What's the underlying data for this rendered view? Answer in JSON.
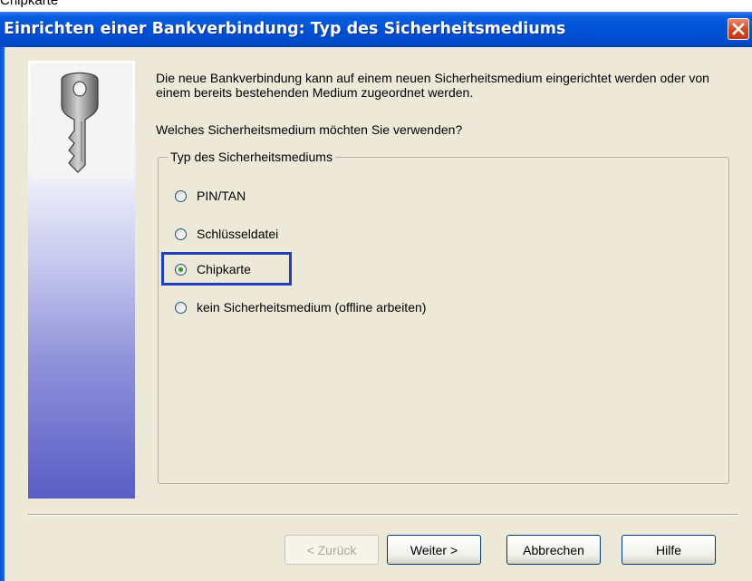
{
  "window": {
    "title": "Einrichten einer Bankverbindung: Typ des Sicherheitsmediums",
    "top_crop_text": "Chipkarte"
  },
  "content": {
    "description": "Die neue Bankverbindung kann  auf einem neuen Sicherheitsmedium eingerichtet werden oder von einem bereits bestehenden Medium zugeordnet werden.",
    "question": "Welches Sicherheitsmedium möchten Sie verwenden?"
  },
  "group": {
    "label": "Typ des Sicherheitsmediums",
    "options": [
      {
        "label": "PIN/TAN",
        "checked": false
      },
      {
        "label": "Schlüsseldatei",
        "checked": false
      },
      {
        "label": "Chipkarte",
        "checked": true
      },
      {
        "label": "kein Sicherheitsmedium (offline arbeiten)",
        "checked": false
      }
    ]
  },
  "buttons": {
    "back": "< Zurück",
    "next": "Weiter >",
    "cancel": "Abbrechen",
    "help": "Hilfe"
  },
  "colors": {
    "titlebar": "#0052d6",
    "highlight": "#1f3fbf",
    "radio_dot": "#21a121",
    "dialog_bg": "#ece9d8"
  },
  "icons": {
    "side": "key-icon",
    "close": "close-icon"
  }
}
